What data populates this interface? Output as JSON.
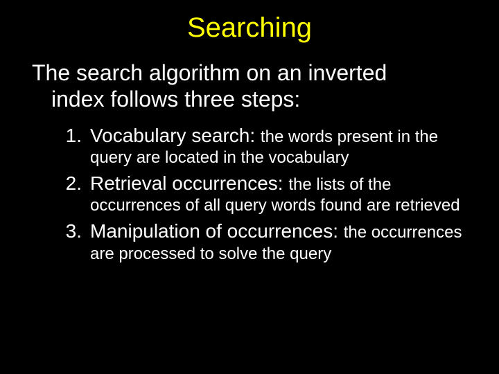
{
  "slide": {
    "title": "Searching",
    "intro_line1": "The search algorithm on an inverted",
    "intro_line2": "index follows three steps:",
    "items": [
      {
        "num": "1.",
        "term": "Vocabulary search: ",
        "desc": "the words present in the query are located in the vocabulary"
      },
      {
        "num": "2.",
        "term": "Retrieval occurrences: ",
        "desc": "the lists of the occurrences of all query words found are retrieved"
      },
      {
        "num": "3.",
        "term": "Manipulation of occurrences: ",
        "desc": "the occurrences are processed to solve the query"
      }
    ]
  }
}
